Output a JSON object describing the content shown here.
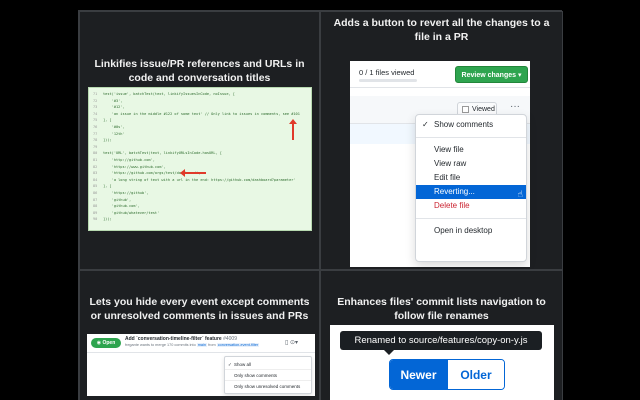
{
  "captions": {
    "linkify": "Linkifies issue/PR references and URLs in code and conversation titles",
    "revert": "Adds a button to revert all the changes to a file in a PR",
    "timeline": "Lets you hide every event except comments or unresolved comments in issues and PRs",
    "renames": "Enhances files' commit lists navigation to follow file renames"
  },
  "code": {
    "lines": [
      {
        "n": "71",
        "t": "test('issue', batchTest(text, linkifyIssuesInCode, noIssue, ["
      },
      {
        "n": "72",
        "t": "    '#3',"
      },
      {
        "n": "73",
        "t": "    '#12',"
      },
      {
        "n": "74",
        "t": "    'an issue in the middle #122 of some text' // Only link to issues in comments, see #101"
      },
      {
        "n": "75",
        "t": "], ["
      },
      {
        "n": "76",
        "t": "    '#0s',"
      },
      {
        "n": "77",
        "t": "    '12th'"
      },
      {
        "n": "78",
        "t": "]));"
      },
      {
        "n": "79",
        "t": ""
      },
      {
        "n": "80",
        "t": "test('URL', batchTest(text, linkifyURLsInCode.hasURL, ["
      },
      {
        "n": "81",
        "t": "    'http://github.com',"
      },
      {
        "n": "82",
        "t": "    'https://www.github.com',"
      },
      {
        "n": "83",
        "t": "    'https://github.com/orgs/test/dashboard',"
      },
      {
        "n": "84",
        "t": "    'a long string of text with a url in the end: https://github.com/dashboard?parameter'"
      },
      {
        "n": "85",
        "t": "], ["
      },
      {
        "n": "86",
        "t": "    'https://github',"
      },
      {
        "n": "87",
        "t": "    'github',"
      },
      {
        "n": "88",
        "t": "    'github.com',"
      },
      {
        "n": "89",
        "t": "    'github/whatever/test'"
      },
      {
        "n": "90",
        "t": "]));"
      }
    ]
  },
  "pr": {
    "files_viewed": "0 / 1 files viewed",
    "review_button": "Review changes ▾",
    "viewed_label": "Viewed",
    "more": "···",
    "menu": [
      {
        "label": "Show comments",
        "checked": true
      },
      {
        "sep": true
      },
      {
        "label": "View file"
      },
      {
        "label": "View raw"
      },
      {
        "label": "Edit file"
      },
      {
        "label": "Reverting...",
        "selected": true
      },
      {
        "label": "Delete file",
        "danger": true
      },
      {
        "sep": true
      },
      {
        "label": "Open in desktop"
      }
    ]
  },
  "timeline": {
    "badge": "Open",
    "title": "Add `conversation-timeline-filter` feature",
    "number": "#4009",
    "subtitle_pre": "fregante wants to merge 170 commits into",
    "base": "main",
    "from": "from",
    "head": "conversation-event-filter",
    "icons": "▯ ⊙▾",
    "menu": [
      {
        "label": "Show all",
        "checked": true
      },
      {
        "label": "Only show comments"
      },
      {
        "label": "Only show unresolved comments"
      }
    ]
  },
  "renames": {
    "tooltip": "Renamed to source/features/copy-on-y.js",
    "newer": "Newer",
    "older": "Older"
  }
}
